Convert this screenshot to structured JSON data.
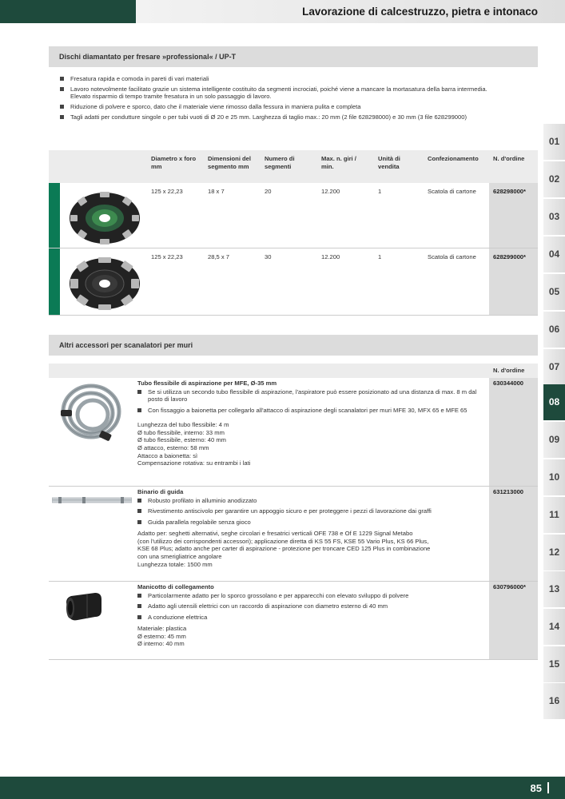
{
  "header": {
    "title": "Lavorazione di calcestruzzo, pietra e intonaco"
  },
  "section1": {
    "title": "Dischi diamantato per fresare »professional« / UP-T",
    "bullets": [
      "Fresatura rapida e comoda in pareti di vari materiali",
      "Lavoro notevolmente facilitato grazie un sistema intelligente costituito da segmenti incrociati, poiché viene a mancare la mortasatura della barra intermedia. Elevato risparmio di tempo tramite fresatura in un solo passaggio di lavoro.",
      "Riduzione di polvere e sporco, dato che il materiale viene rimosso dalla fessura in maniera pulita e completa",
      "Tagli adatti per condutture singole o per tubi vuoti di Ø 20 e 25 mm. Larghezza di taglio max.: 20 mm (2 file 628298000) e 30 mm (3 file 628299000)"
    ],
    "columns": {
      "diam": "Diametro x foro mm",
      "dim": "Dimensioni del segmento mm",
      "num": "Numero di segmenti",
      "giri": "Max. n. giri / min.",
      "unit": "Unità di vendita",
      "conf": "Confezionamento",
      "ord": "N. d'ordine"
    },
    "rows": [
      {
        "diam": "125 x 22,23",
        "dim": "18 x 7",
        "num": "20",
        "giri": "12.200",
        "unit": "1",
        "conf": "Scatola di cartone",
        "ord": "628298000*"
      },
      {
        "diam": "125 x 22,23",
        "dim": "28,5 x 7",
        "num": "30",
        "giri": "12.200",
        "unit": "1",
        "conf": "Scatola di cartone",
        "ord": "628299000*"
      }
    ]
  },
  "section2": {
    "title": "Altri accessori per scanalatori per muri",
    "ord_header": "N. d'ordine",
    "items": [
      {
        "title": "Tubo flessibile di aspirazione per MFE, Ø-35 mm",
        "bullets": [
          "Se si utilizza un secondo tubo flessibile di aspirazione, l'aspiratore può essere posizionato ad una distanza di max. 8 m dal posto di lavoro",
          "Con fissaggio a baionetta per collegarlo all'attacco di aspirazione degli scanalatori per muri MFE 30, MFX 65 e MFE 65"
        ],
        "lines": [
          "Lunghezza del tubo flessibile: 4 m",
          "Ø tubo flessibile, interno: 33 mm",
          "Ø tubo flessibile, esterno: 40 mm",
          "Ø attacco, esterno: 58 mm",
          "Attacco a baionetta: sì",
          "Compensazione rotativa: su entrambi i lati"
        ],
        "code": "630344000"
      },
      {
        "title": "Binario di guida",
        "bullets": [
          "Robusto profilato in alluminio anodizzato",
          "Rivestimento antiscivolo per garantire un appoggio sicuro e per proteggere i pezzi di lavorazione dai graffi",
          "Guida parallela regolabile senza gioco"
        ],
        "lines": [
          "Adatto per: seghetti alternativi, seghe circolari e fresatrici verticali OFE 738 e Of E 1229 Signal Metabo",
          "(con l'utilizzo dei corrispondenti accessori); applicazione diretta di KS 55 FS, KSE 55 Vario Plus, KS 66 Plus,",
          "KSE 68 Plus; adatto anche per carter di aspirazione - protezione per troncare CED 125 Plus in combinazione",
          "con una smerigliatrice angolare",
          "Lunghezza totale: 1500 mm"
        ],
        "code": "631213000"
      },
      {
        "title": "Manicotto di collegamento",
        "bullets": [
          "Particolarmente adatto per lo sporco grossolano e per apparecchi con elevato sviluppo di polvere",
          "Adatto agli utensili elettrici con un raccordo di aspirazione con diametro esterno di 40 mm",
          "A conduzione elettrica"
        ],
        "lines": [
          "Materiale: plastica",
          "Ø esterno: 45 mm",
          "Ø interno: 40 mm"
        ],
        "code": "630796000*"
      }
    ]
  },
  "tabs": [
    "01",
    "02",
    "03",
    "04",
    "05",
    "06",
    "07",
    "08",
    "09",
    "10",
    "11",
    "12",
    "13",
    "14",
    "15",
    "16"
  ],
  "active_tab": "08",
  "footer": {
    "page": "85"
  },
  "colors": {
    "brand_green": "#1e4a3c",
    "accent_green": "#0b7a55",
    "header_grey": "#dcdcdc"
  }
}
